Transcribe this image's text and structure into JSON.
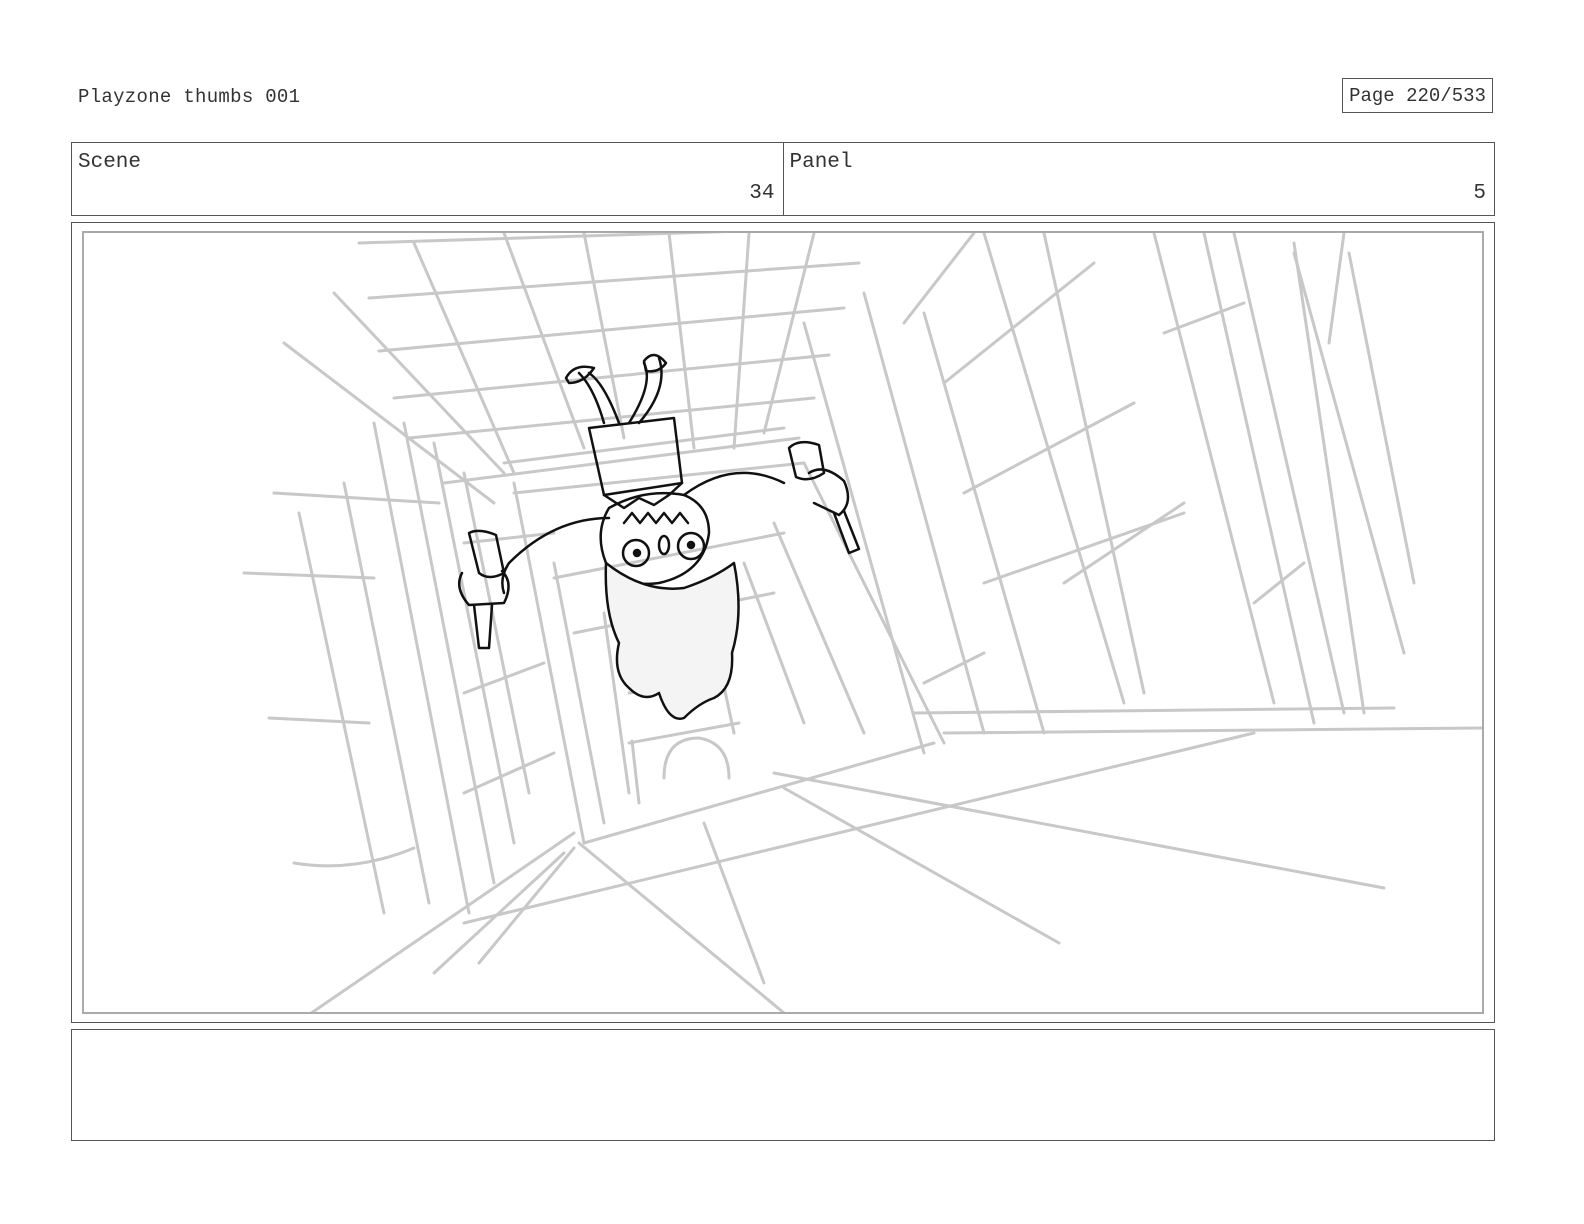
{
  "document": {
    "title": "Playzone thumbs 001",
    "page_label": "Page 220/533"
  },
  "scene": {
    "label": "Scene",
    "value": "34"
  },
  "panel": {
    "label": "Panel",
    "value": "5"
  },
  "notes": {
    "text": ""
  },
  "colors": {
    "sketch_gray": "#c8c8c8",
    "ink": "#111111",
    "frame_border": "#555555"
  },
  "illustration": {
    "description_icon": "storyboard-sketch-icon"
  }
}
